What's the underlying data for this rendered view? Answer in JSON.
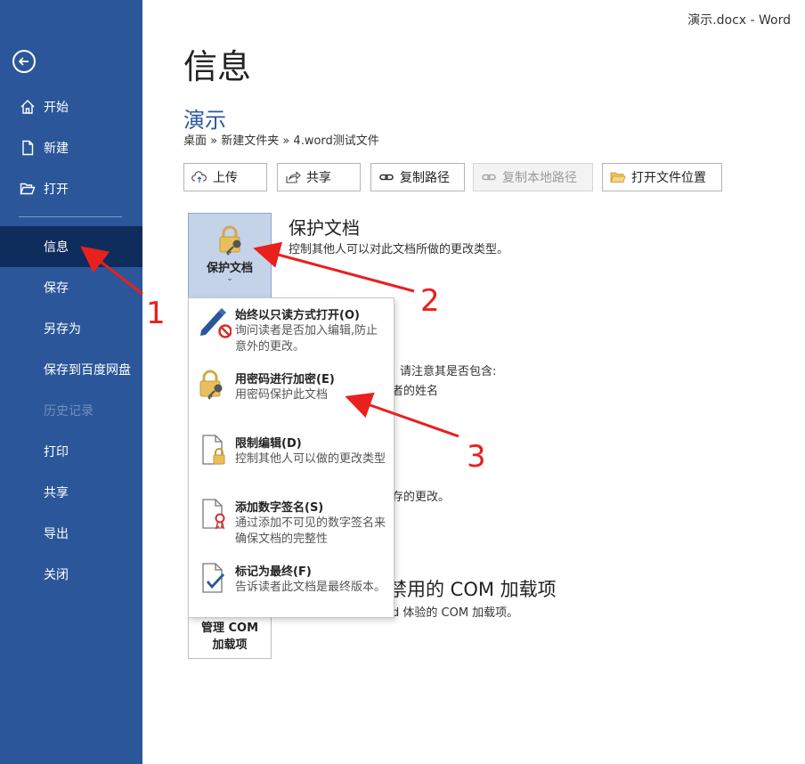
{
  "window": {
    "title": "演示.docx  -  Word"
  },
  "sidebar": {
    "items": [
      {
        "label": "开始",
        "icon": "home-icon"
      },
      {
        "label": "新建",
        "icon": "new-doc-icon"
      },
      {
        "label": "打开",
        "icon": "folder-open-icon"
      },
      {
        "label": "信息"
      },
      {
        "label": "保存"
      },
      {
        "label": "另存为"
      },
      {
        "label": "保存到百度网盘"
      },
      {
        "label": "历史记录"
      },
      {
        "label": "打印"
      },
      {
        "label": "共享"
      },
      {
        "label": "导出"
      },
      {
        "label": "关闭"
      }
    ]
  },
  "main": {
    "page_title": "信息",
    "doc_title": "演示",
    "breadcrumb": "桌面 » 新建文件夹 » 4.word测试文件",
    "toolbar": {
      "upload": "上传",
      "share": "共享",
      "copy_path": "复制路径",
      "copy_local_path": "复制本地路径",
      "open_location": "打开文件位置"
    },
    "protect": {
      "button_label": "保护文档",
      "caret": "⌄",
      "heading": "保护文档",
      "description": "控制其他人可以对此文档所做的更改类型。"
    },
    "background": {
      "inspect_fragment": "请注意其是否包含:",
      "author_fragment": "者的姓名",
      "versions_fragment": "存的更改。",
      "com_heading_fragment": "禁用的 COM 加载项",
      "com_desc_fragment": "d 体验的 COM 加载项。",
      "com_button_line1": "管理 COM",
      "com_button_line2": "加载项"
    },
    "dropdown": [
      {
        "title": "始终以只读方式打开(O)",
        "desc": "询问读者是否加入编辑,防止意外的更改。",
        "icon": "pencil-no-icon"
      },
      {
        "title": "用密码进行加密(E)",
        "desc": "用密码保护此文档",
        "icon": "lock-key-icon"
      },
      {
        "title": "限制编辑(D)",
        "desc": "控制其他人可以做的更改类型",
        "icon": "doc-lock-icon"
      },
      {
        "title": "添加数字签名(S)",
        "desc": "通过添加不可见的数字签名来确保文档的完整性",
        "icon": "doc-ribbon-icon"
      },
      {
        "title": "标记为最终(F)",
        "desc": "告诉读者此文档是最终版本。",
        "icon": "doc-check-icon"
      }
    ]
  },
  "annotations": {
    "n1": "1",
    "n2": "2",
    "n3": "3",
    "color": "#e8201e"
  }
}
